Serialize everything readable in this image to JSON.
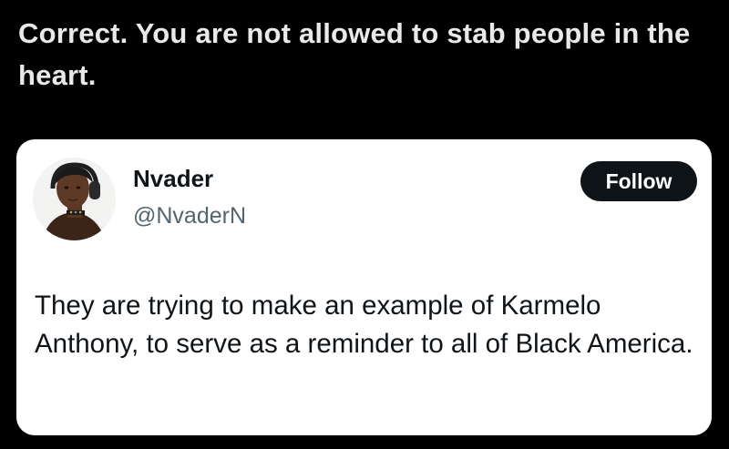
{
  "caption": {
    "text": "Correct. You are not allowed to stab people in the heart."
  },
  "tweet": {
    "display_name": "Nvader",
    "handle": "@NvaderN",
    "follow_label": "Follow",
    "text": "They are trying to make an example of Karmelo Anthony, to serve as a reminder to all of Black America."
  },
  "colors": {
    "background": "#000000",
    "caption_text": "#e7e9ea",
    "card_background": "#ffffff",
    "primary_text": "#0f1419",
    "secondary_text": "#536471",
    "follow_button": "#0f1419"
  },
  "icons": {
    "avatar": "profile-photo"
  }
}
